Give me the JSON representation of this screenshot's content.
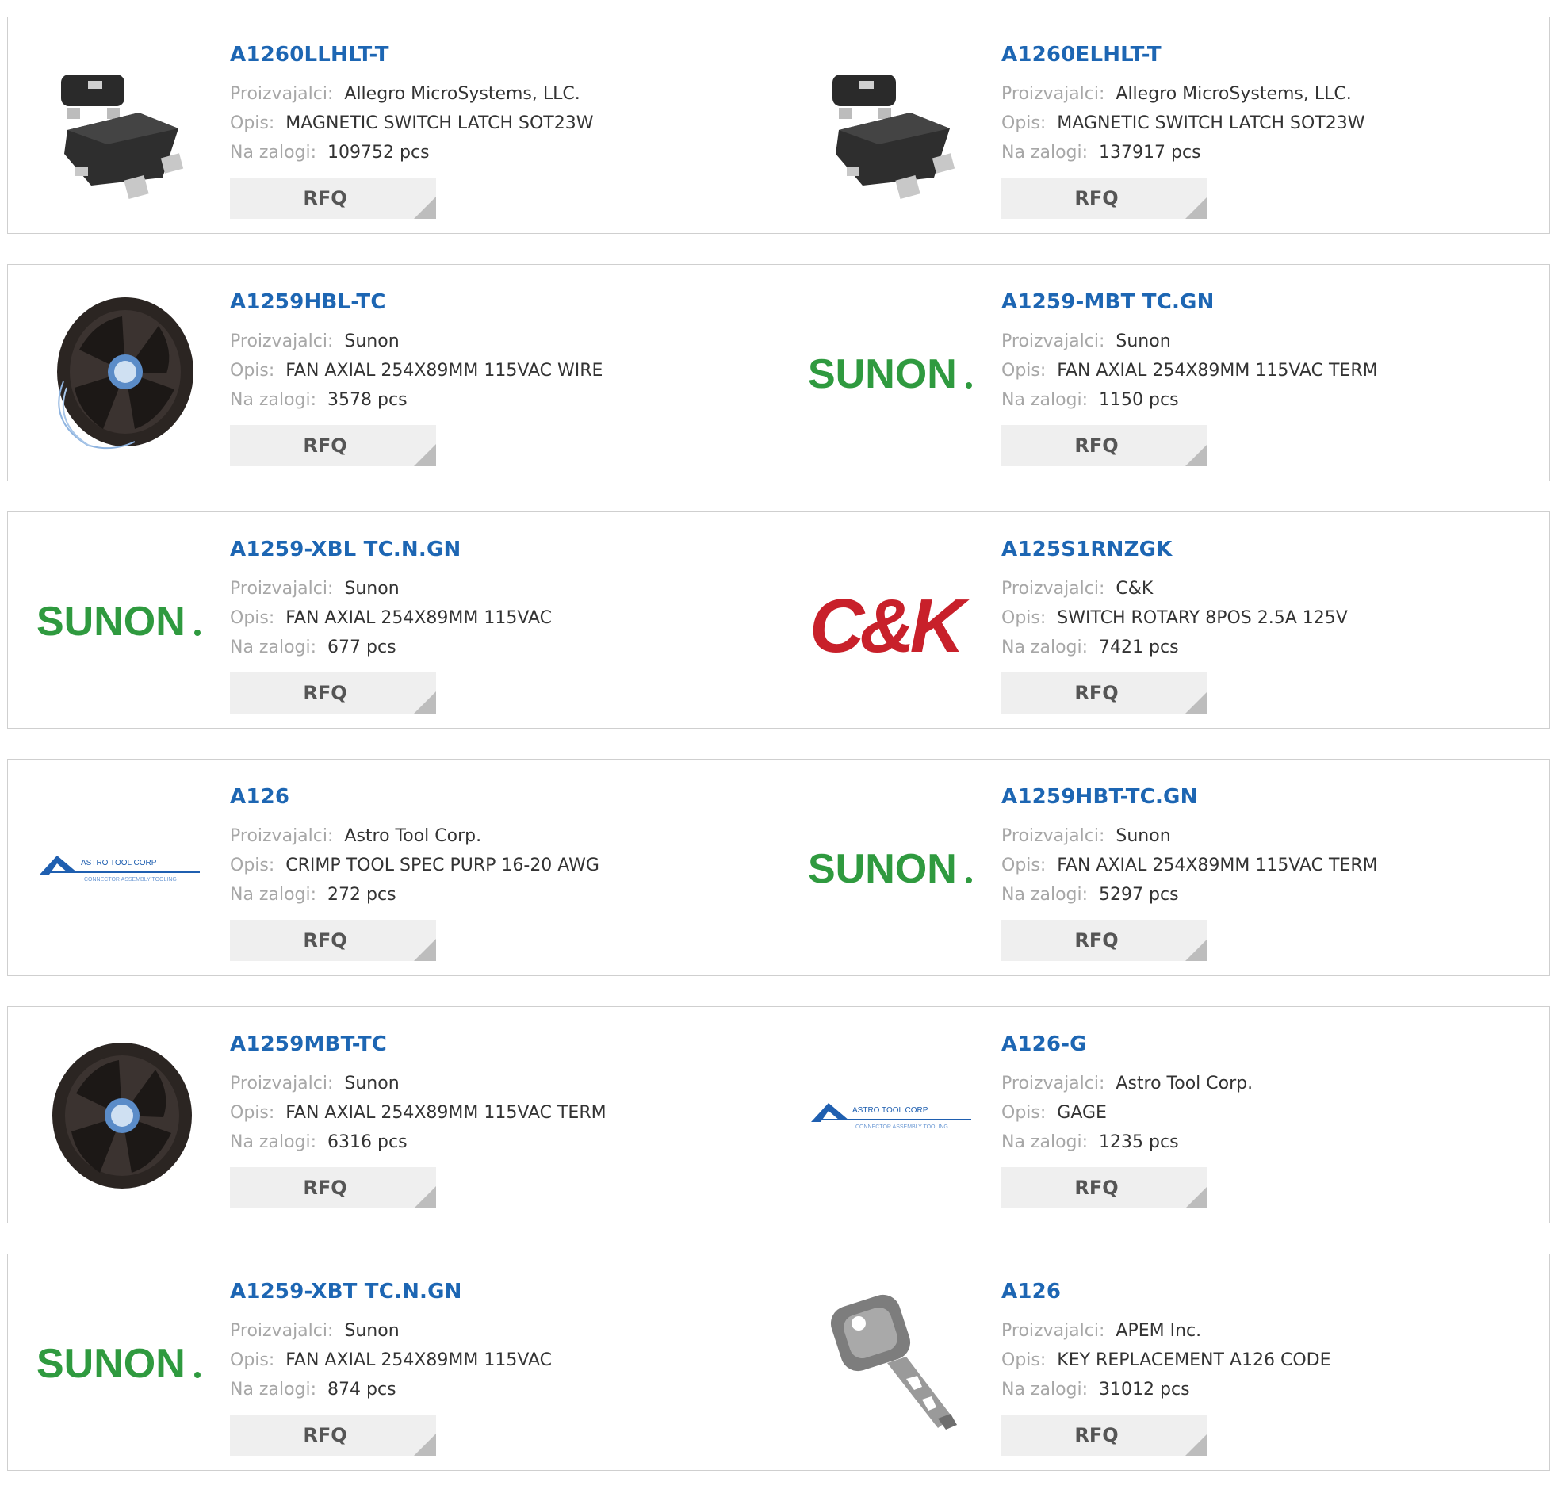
{
  "labels": {
    "manufacturer": "Proizvajalci:",
    "description": "Opis:",
    "stock": "Na zalogi:",
    "rfq": "RFQ"
  },
  "products": [
    {
      "part": "A1260LLHLT-T",
      "manufacturer": "Allegro MicroSystems, LLC.",
      "description": "MAGNETIC SWITCH LATCH SOT23W",
      "stock": "109752 pcs",
      "image": "sot23-chip"
    },
    {
      "part": "A1260ELHLT-T",
      "manufacturer": "Allegro MicroSystems, LLC.",
      "description": "MAGNETIC SWITCH LATCH SOT23W",
      "stock": "137917 pcs",
      "image": "sot23-chip"
    },
    {
      "part": "A1259HBL-TC",
      "manufacturer": "Sunon",
      "description": "FAN AXIAL 254X89MM 115VAC WIRE",
      "stock": "3578 pcs",
      "image": "axial-fan-wired"
    },
    {
      "part": "A1259-MBT TC.GN",
      "manufacturer": "Sunon",
      "description": "FAN AXIAL 254X89MM 115VAC TERM",
      "stock": "1150 pcs",
      "image": "sunon-logo"
    },
    {
      "part": "A1259-XBL TC.N.GN",
      "manufacturer": "Sunon",
      "description": "FAN AXIAL 254X89MM 115VAC",
      "stock": "677 pcs",
      "image": "sunon-logo"
    },
    {
      "part": "A125S1RNZGK",
      "manufacturer": "C&K",
      "description": "SWITCH ROTARY 8POS 2.5A 125V",
      "stock": "7421 pcs",
      "image": "ck-logo"
    },
    {
      "part": "A126",
      "manufacturer": "Astro Tool Corp.",
      "description": "CRIMP TOOL SPEC PURP 16-20 AWG",
      "stock": "272 pcs",
      "image": "astro-tool-logo"
    },
    {
      "part": "A1259HBT-TC.GN",
      "manufacturer": "Sunon",
      "description": "FAN AXIAL 254X89MM 115VAC TERM",
      "stock": "5297 pcs",
      "image": "sunon-logo"
    },
    {
      "part": "A1259MBT-TC",
      "manufacturer": "Sunon",
      "description": "FAN AXIAL 254X89MM 115VAC TERM",
      "stock": "6316 pcs",
      "image": "axial-fan"
    },
    {
      "part": "A126-G",
      "manufacturer": "Astro Tool Corp.",
      "description": "GAGE",
      "stock": "1235 pcs",
      "image": "astro-tool-logo"
    },
    {
      "part": "A1259-XBT TC.N.GN",
      "manufacturer": "Sunon",
      "description": "FAN AXIAL 254X89MM 115VAC",
      "stock": "874 pcs",
      "image": "sunon-logo"
    },
    {
      "part": "A126",
      "manufacturer": "APEM Inc.",
      "description": "KEY REPLACEMENT A126 CODE",
      "stock": "31012 pcs",
      "image": "key"
    }
  ],
  "logos": {
    "sunon": "SUNON",
    "ck": "C&K",
    "astro_line1": "ASTRO TOOL CORP",
    "astro_line2": "CONNECTOR ASSEMBLY TOOLING"
  },
  "colors": {
    "part_link": "#1d66b3",
    "label": "#a7a7a7",
    "value": "#333333",
    "rfq_bg": "#efefef",
    "sunon_green": "#2f9a3f",
    "ck_red": "#c8202a",
    "astro_blue": "#1f5fb0"
  }
}
